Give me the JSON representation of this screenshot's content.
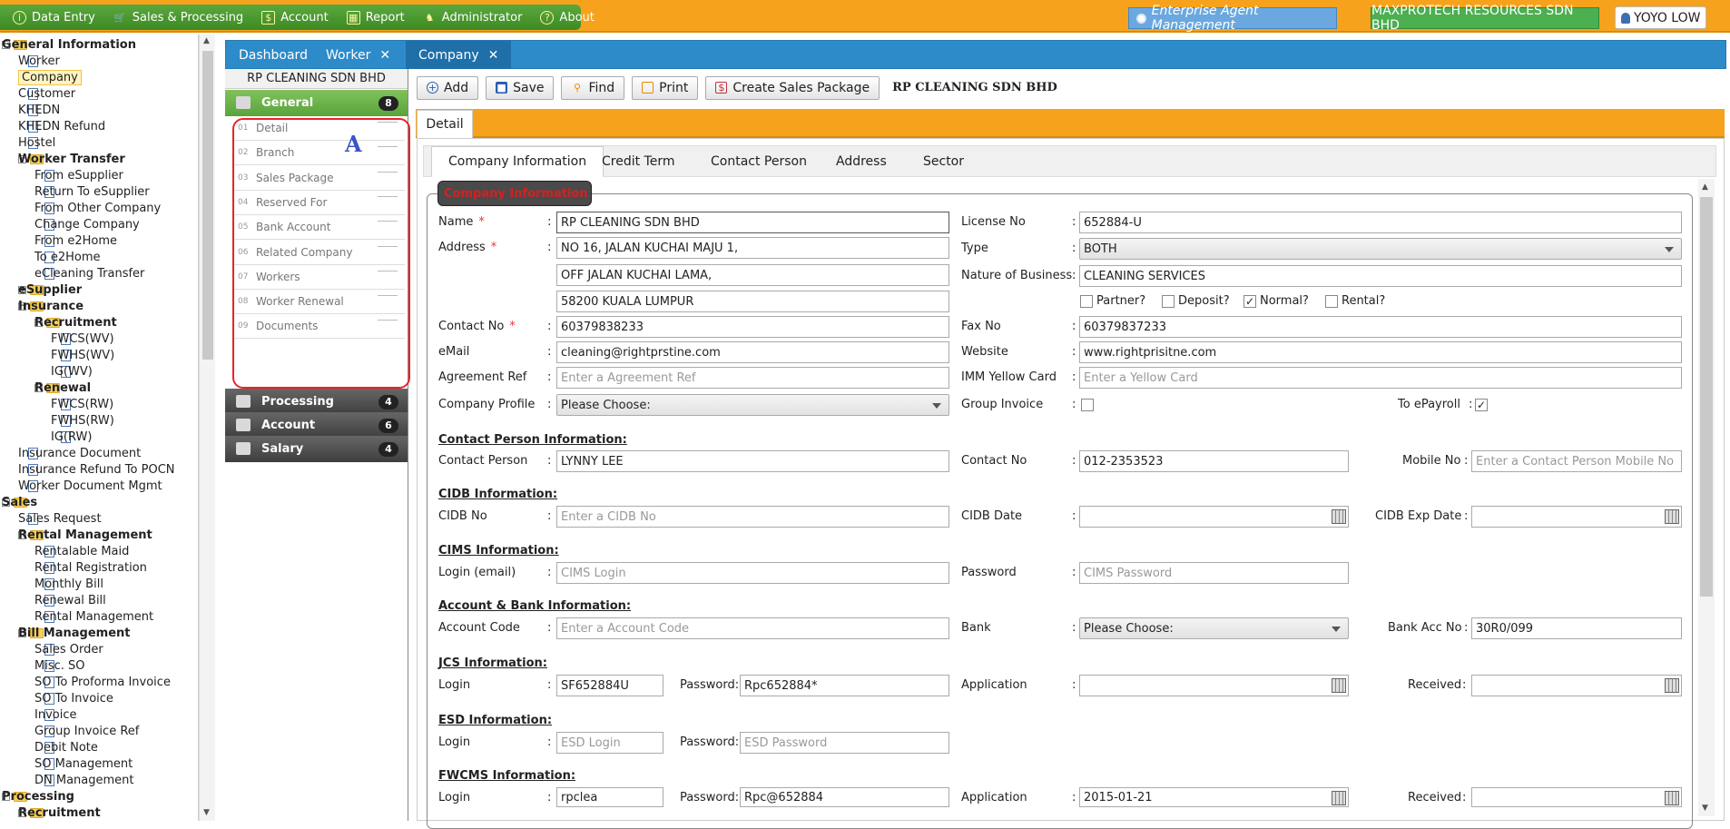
{
  "menu": [
    {
      "icon": "info-icon",
      "label": "Data Entry"
    },
    {
      "icon": "cart-icon",
      "label": "Sales & Processing"
    },
    {
      "icon": "account-icon",
      "label": "Account"
    },
    {
      "icon": "grid-icon",
      "label": "Report"
    },
    {
      "icon": "admin-icon",
      "label": "Administrator"
    },
    {
      "icon": "help-icon",
      "label": "About"
    }
  ],
  "header": {
    "enterprise": "Enterprise Agent Management",
    "company": "MAXPROTECH RESOURCES SDN BHD",
    "user": "YOYO LOW"
  },
  "tree": [
    {
      "t": "General Information",
      "lvl": 0,
      "fold": true,
      "bold": true
    },
    {
      "t": "Worker",
      "lvl": 1
    },
    {
      "t": "Company",
      "lvl": 1,
      "sel": true
    },
    {
      "t": "Customer",
      "lvl": 1
    },
    {
      "t": "KHEDN",
      "lvl": 1
    },
    {
      "t": "KHEDN Refund",
      "lvl": 1
    },
    {
      "t": "Hostel",
      "lvl": 1
    },
    {
      "t": "Worker Transfer",
      "lvl": 1,
      "fold": true,
      "bold": true
    },
    {
      "t": "From eSupplier",
      "lvl": 2
    },
    {
      "t": "Return To eSupplier",
      "lvl": 2
    },
    {
      "t": "From Other Company",
      "lvl": 2
    },
    {
      "t": "Change Company",
      "lvl": 2
    },
    {
      "t": "From e2Home",
      "lvl": 2
    },
    {
      "t": "To e2Home",
      "lvl": 2
    },
    {
      "t": "eCleaning Transfer",
      "lvl": 2
    },
    {
      "t": "eSupplier",
      "lvl": 1,
      "fold": true,
      "bold": true,
      "plus": true
    },
    {
      "t": "Insurance",
      "lvl": 1,
      "fold": true,
      "bold": true
    },
    {
      "t": "Recruitment",
      "lvl": 2,
      "fold": true,
      "bold": true
    },
    {
      "t": "FWCS(WV)",
      "lvl": 3
    },
    {
      "t": "FWHS(WV)",
      "lvl": 3
    },
    {
      "t": "IG(WV)",
      "lvl": 3
    },
    {
      "t": "Renewal",
      "lvl": 2,
      "fold": true,
      "bold": true
    },
    {
      "t": "FWCS(RW)",
      "lvl": 3
    },
    {
      "t": "FWHS(RW)",
      "lvl": 3
    },
    {
      "t": "IG(RW)",
      "lvl": 3
    },
    {
      "t": "Insurance Document",
      "lvl": 1
    },
    {
      "t": "Insurance Refund To POCN",
      "lvl": 1
    },
    {
      "t": "Worker Document Mgmt",
      "lvl": 1
    },
    {
      "t": "Sales",
      "lvl": 0,
      "fold": true,
      "bold": true
    },
    {
      "t": "Sales Request",
      "lvl": 1
    },
    {
      "t": "Rental Management",
      "lvl": 1,
      "fold": true,
      "bold": true
    },
    {
      "t": "Rentalable Maid",
      "lvl": 2
    },
    {
      "t": "Rental Registration",
      "lvl": 2
    },
    {
      "t": "Monthly Bill",
      "lvl": 2
    },
    {
      "t": "Renewal Bill",
      "lvl": 2
    },
    {
      "t": "Rental Management",
      "lvl": 2
    },
    {
      "t": "Bill Management",
      "lvl": 1,
      "fold": true,
      "bold": true
    },
    {
      "t": "Sales Order",
      "lvl": 2
    },
    {
      "t": "Misc. SO",
      "lvl": 2
    },
    {
      "t": "SO To Proforma Invoice",
      "lvl": 2
    },
    {
      "t": "SO To Invoice",
      "lvl": 2
    },
    {
      "t": "Invoice",
      "lvl": 2
    },
    {
      "t": "Group Invoice Ref",
      "lvl": 2
    },
    {
      "t": "Debit Note",
      "lvl": 2
    },
    {
      "t": "SO Management",
      "lvl": 2
    },
    {
      "t": "DN Management",
      "lvl": 2
    },
    {
      "t": "Processing",
      "lvl": 0,
      "fold": true,
      "bold": true
    },
    {
      "t": "Recruitment",
      "lvl": 1,
      "fold": true,
      "bold": true
    }
  ],
  "tabs": [
    "Dashboard",
    "Worker",
    "Company"
  ],
  "module": {
    "title": "RP CLEANING SDN BHD",
    "general": {
      "label": "General",
      "count": "8"
    },
    "items": [
      {
        "num": "01",
        "label": "Detail"
      },
      {
        "num": "02",
        "label": "Branch"
      },
      {
        "num": "03",
        "label": "Sales Package"
      },
      {
        "num": "04",
        "label": "Reserved For"
      },
      {
        "num": "05",
        "label": "Bank Account"
      },
      {
        "num": "06",
        "label": "Related Company"
      },
      {
        "num": "07",
        "label": "Workers"
      },
      {
        "num": "08",
        "label": "Worker Renewal"
      },
      {
        "num": "09",
        "label": "Documents"
      }
    ],
    "others": [
      {
        "label": "Processing",
        "count": "4"
      },
      {
        "label": "Account",
        "count": "6"
      },
      {
        "label": "Salary",
        "count": "4"
      }
    ],
    "annotation": "A"
  },
  "toolbar": {
    "add": "Add",
    "save": "Save",
    "find": "Find",
    "print": "Print",
    "create": "Create Sales Package",
    "company": "RP CLEANING SDN BHD"
  },
  "detail_tab": "Detail",
  "content_tabs": [
    "Company Information",
    "Credit Term",
    "Contact Person",
    "Address",
    "Sector"
  ],
  "legend": "Company Information",
  "form": {
    "name_lbl": "Name",
    "name": "RP CLEANING SDN BHD",
    "addr_lbl": "Address",
    "addr1": "NO 16, JALAN KUCHAI MAJU 1,",
    "addr2": "OFF JALAN KUCHAI LAMA,",
    "addr3": "58200 KUALA LUMPUR",
    "contact_lbl": "Contact No",
    "contact": "60379838233",
    "email_lbl": "eMail",
    "email": "cleaning@rightprstine.com",
    "agree_lbl": "Agreement Ref",
    "agree_ph": "Enter a Agreement Ref",
    "profile_lbl": "Company Profile",
    "profile": "Please Choose:",
    "license_lbl": "License No",
    "license": "652884-U",
    "type_lbl": "Type",
    "type": "BOTH",
    "nature_lbl": "Nature of Business",
    "nature": "CLEANING SERVICES",
    "partner": "Partner?",
    "deposit": "Deposit?",
    "normal": "Normal?",
    "rental": "Rental?",
    "fax_lbl": "Fax No",
    "fax": "60379837233",
    "web_lbl": "Website",
    "web": "www.rightprisitne.com",
    "imm_lbl": "IMM Yellow Card",
    "imm_ph": "Enter a Yellow Card",
    "group_lbl": "Group Invoice",
    "payroll_lbl": "To ePayroll",
    "cp_sect": "Contact Person Information:",
    "cp_lbl": "Contact Person",
    "cp": "LYNNY LEE",
    "cpno_lbl": "Contact No",
    "cpno": "012-2353523",
    "mobile_lbl": "Mobile No",
    "mobile_ph": "Enter a Contact Person Mobile No",
    "cidb_sect": "CIDB Information:",
    "cidb_lbl": "CIDB No",
    "cidb_ph": "Enter a CIDB No",
    "cidbdate_lbl": "CIDB Date",
    "cidbexp_lbl": "CIDB Exp Date",
    "cims_sect": "CIMS Information:",
    "cims_lbl": "Login (email)",
    "cims_ph": "CIMS Login",
    "cimspw_lbl": "Password",
    "cimspw_ph": "CIMS Password",
    "bank_sect": "Account & Bank Information:",
    "acc_lbl": "Account Code",
    "acc_ph": "Enter a Account Code",
    "bank_lbl": "Bank",
    "bank": "Please Choose:",
    "bankacc_lbl": "Bank Acc No",
    "bankacc": "30R0/099",
    "jcs_sect": "JCS Information:",
    "jcs_lbl": "Login",
    "jcs": "SF652884U",
    "jcspw_lbl": "Password:",
    "jcspw": "Rpc652884*",
    "jcsapp_lbl": "Application",
    "jcsrec_lbl": "Received",
    "esd_sect": "ESD Information:",
    "esd_lbl": "Login",
    "esd_ph": "ESD Login",
    "esdpw_lbl": "Password:",
    "esdpw_ph": "ESD Password",
    "fw_sect": "FWCMS Information:",
    "fw_lbl": "Login",
    "fw": "rpclea",
    "fwpw_lbl": "Password:",
    "fwpw": "Rpc@652884",
    "fwapp_lbl": "Application",
    "fwapp": "2015-01-21",
    "fwrec_lbl": "Received"
  }
}
